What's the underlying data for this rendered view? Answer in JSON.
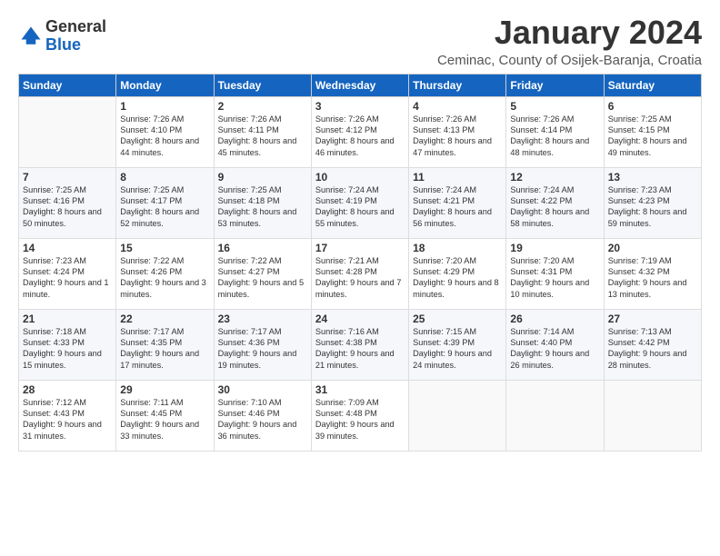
{
  "header": {
    "logo_general": "General",
    "logo_blue": "Blue",
    "month_title": "January 2024",
    "subtitle": "Ceminac, County of Osijek-Baranja, Croatia"
  },
  "days_of_week": [
    "Sunday",
    "Monday",
    "Tuesday",
    "Wednesday",
    "Thursday",
    "Friday",
    "Saturday"
  ],
  "weeks": [
    [
      {
        "day": "",
        "sunrise": "",
        "sunset": "",
        "daylight": ""
      },
      {
        "day": "1",
        "sunrise": "Sunrise: 7:26 AM",
        "sunset": "Sunset: 4:10 PM",
        "daylight": "Daylight: 8 hours and 44 minutes."
      },
      {
        "day": "2",
        "sunrise": "Sunrise: 7:26 AM",
        "sunset": "Sunset: 4:11 PM",
        "daylight": "Daylight: 8 hours and 45 minutes."
      },
      {
        "day": "3",
        "sunrise": "Sunrise: 7:26 AM",
        "sunset": "Sunset: 4:12 PM",
        "daylight": "Daylight: 8 hours and 46 minutes."
      },
      {
        "day": "4",
        "sunrise": "Sunrise: 7:26 AM",
        "sunset": "Sunset: 4:13 PM",
        "daylight": "Daylight: 8 hours and 47 minutes."
      },
      {
        "day": "5",
        "sunrise": "Sunrise: 7:26 AM",
        "sunset": "Sunset: 4:14 PM",
        "daylight": "Daylight: 8 hours and 48 minutes."
      },
      {
        "day": "6",
        "sunrise": "Sunrise: 7:25 AM",
        "sunset": "Sunset: 4:15 PM",
        "daylight": "Daylight: 8 hours and 49 minutes."
      }
    ],
    [
      {
        "day": "7",
        "sunrise": "Sunrise: 7:25 AM",
        "sunset": "Sunset: 4:16 PM",
        "daylight": "Daylight: 8 hours and 50 minutes."
      },
      {
        "day": "8",
        "sunrise": "Sunrise: 7:25 AM",
        "sunset": "Sunset: 4:17 PM",
        "daylight": "Daylight: 8 hours and 52 minutes."
      },
      {
        "day": "9",
        "sunrise": "Sunrise: 7:25 AM",
        "sunset": "Sunset: 4:18 PM",
        "daylight": "Daylight: 8 hours and 53 minutes."
      },
      {
        "day": "10",
        "sunrise": "Sunrise: 7:24 AM",
        "sunset": "Sunset: 4:19 PM",
        "daylight": "Daylight: 8 hours and 55 minutes."
      },
      {
        "day": "11",
        "sunrise": "Sunrise: 7:24 AM",
        "sunset": "Sunset: 4:21 PM",
        "daylight": "Daylight: 8 hours and 56 minutes."
      },
      {
        "day": "12",
        "sunrise": "Sunrise: 7:24 AM",
        "sunset": "Sunset: 4:22 PM",
        "daylight": "Daylight: 8 hours and 58 minutes."
      },
      {
        "day": "13",
        "sunrise": "Sunrise: 7:23 AM",
        "sunset": "Sunset: 4:23 PM",
        "daylight": "Daylight: 8 hours and 59 minutes."
      }
    ],
    [
      {
        "day": "14",
        "sunrise": "Sunrise: 7:23 AM",
        "sunset": "Sunset: 4:24 PM",
        "daylight": "Daylight: 9 hours and 1 minute."
      },
      {
        "day": "15",
        "sunrise": "Sunrise: 7:22 AM",
        "sunset": "Sunset: 4:26 PM",
        "daylight": "Daylight: 9 hours and 3 minutes."
      },
      {
        "day": "16",
        "sunrise": "Sunrise: 7:22 AM",
        "sunset": "Sunset: 4:27 PM",
        "daylight": "Daylight: 9 hours and 5 minutes."
      },
      {
        "day": "17",
        "sunrise": "Sunrise: 7:21 AM",
        "sunset": "Sunset: 4:28 PM",
        "daylight": "Daylight: 9 hours and 7 minutes."
      },
      {
        "day": "18",
        "sunrise": "Sunrise: 7:20 AM",
        "sunset": "Sunset: 4:29 PM",
        "daylight": "Daylight: 9 hours and 8 minutes."
      },
      {
        "day": "19",
        "sunrise": "Sunrise: 7:20 AM",
        "sunset": "Sunset: 4:31 PM",
        "daylight": "Daylight: 9 hours and 10 minutes."
      },
      {
        "day": "20",
        "sunrise": "Sunrise: 7:19 AM",
        "sunset": "Sunset: 4:32 PM",
        "daylight": "Daylight: 9 hours and 13 minutes."
      }
    ],
    [
      {
        "day": "21",
        "sunrise": "Sunrise: 7:18 AM",
        "sunset": "Sunset: 4:33 PM",
        "daylight": "Daylight: 9 hours and 15 minutes."
      },
      {
        "day": "22",
        "sunrise": "Sunrise: 7:17 AM",
        "sunset": "Sunset: 4:35 PM",
        "daylight": "Daylight: 9 hours and 17 minutes."
      },
      {
        "day": "23",
        "sunrise": "Sunrise: 7:17 AM",
        "sunset": "Sunset: 4:36 PM",
        "daylight": "Daylight: 9 hours and 19 minutes."
      },
      {
        "day": "24",
        "sunrise": "Sunrise: 7:16 AM",
        "sunset": "Sunset: 4:38 PM",
        "daylight": "Daylight: 9 hours and 21 minutes."
      },
      {
        "day": "25",
        "sunrise": "Sunrise: 7:15 AM",
        "sunset": "Sunset: 4:39 PM",
        "daylight": "Daylight: 9 hours and 24 minutes."
      },
      {
        "day": "26",
        "sunrise": "Sunrise: 7:14 AM",
        "sunset": "Sunset: 4:40 PM",
        "daylight": "Daylight: 9 hours and 26 minutes."
      },
      {
        "day": "27",
        "sunrise": "Sunrise: 7:13 AM",
        "sunset": "Sunset: 4:42 PM",
        "daylight": "Daylight: 9 hours and 28 minutes."
      }
    ],
    [
      {
        "day": "28",
        "sunrise": "Sunrise: 7:12 AM",
        "sunset": "Sunset: 4:43 PM",
        "daylight": "Daylight: 9 hours and 31 minutes."
      },
      {
        "day": "29",
        "sunrise": "Sunrise: 7:11 AM",
        "sunset": "Sunset: 4:45 PM",
        "daylight": "Daylight: 9 hours and 33 minutes."
      },
      {
        "day": "30",
        "sunrise": "Sunrise: 7:10 AM",
        "sunset": "Sunset: 4:46 PM",
        "daylight": "Daylight: 9 hours and 36 minutes."
      },
      {
        "day": "31",
        "sunrise": "Sunrise: 7:09 AM",
        "sunset": "Sunset: 4:48 PM",
        "daylight": "Daylight: 9 hours and 39 minutes."
      },
      {
        "day": "",
        "sunrise": "",
        "sunset": "",
        "daylight": ""
      },
      {
        "day": "",
        "sunrise": "",
        "sunset": "",
        "daylight": ""
      },
      {
        "day": "",
        "sunrise": "",
        "sunset": "",
        "daylight": ""
      }
    ]
  ]
}
